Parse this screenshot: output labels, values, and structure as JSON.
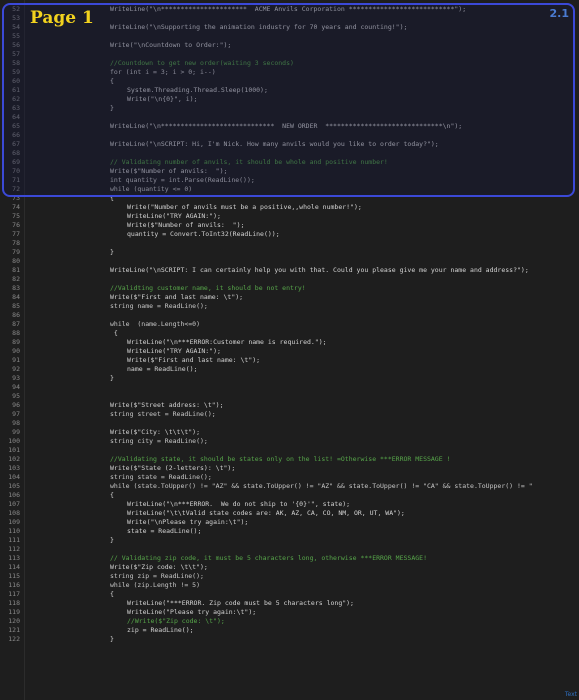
{
  "overlay": {
    "page_label": "Page 1",
    "version_label": "2.1",
    "watermark": "Text"
  },
  "lines": [
    {
      "n": "52",
      "indent": 0,
      "code": "WriteLine(\"\\n**********************  ACME Anvils Corporation ***************************\");",
      "kind": "plain"
    },
    {
      "n": "53",
      "indent": 0,
      "code": "",
      "kind": "plain"
    },
    {
      "n": "54",
      "indent": 0,
      "code": "WriteLine(\"\\nSupporting the animation industry for 70 years and counting!\");",
      "kind": "plain"
    },
    {
      "n": "55",
      "indent": 0,
      "code": "",
      "kind": "plain"
    },
    {
      "n": "56",
      "indent": 0,
      "code": "Write(\"\\nCountdown to Order:\");",
      "kind": "plain"
    },
    {
      "n": "57",
      "indent": 0,
      "code": "",
      "kind": "plain"
    },
    {
      "n": "58",
      "indent": 0,
      "code": "//Countdown to get new order(waiting 3 seconds)",
      "kind": "comment"
    },
    {
      "n": "59",
      "indent": 0,
      "code": "for (int i = 3; i > 0; i--)",
      "kind": "keyword"
    },
    {
      "n": "60",
      "indent": 0,
      "code": "{",
      "kind": "plain"
    },
    {
      "n": "61",
      "indent": 1,
      "code": "System.Threading.Thread.Sleep(1000);",
      "kind": "plain"
    },
    {
      "n": "62",
      "indent": 1,
      "code": "Write(\"\\n{0}\", i);",
      "kind": "plain"
    },
    {
      "n": "63",
      "indent": 0,
      "code": "}",
      "kind": "plain"
    },
    {
      "n": "64",
      "indent": 0,
      "code": "",
      "kind": "plain"
    },
    {
      "n": "65",
      "indent": 0,
      "code": "WriteLine(\"\\n*****************************  NEW ORDER  ******************************\\n\");",
      "kind": "plain"
    },
    {
      "n": "66",
      "indent": 0,
      "code": "",
      "kind": "plain"
    },
    {
      "n": "67",
      "indent": 0,
      "code": "WriteLine(\"\\nSCRIPT: Hi, I'm Nick. How many anvils would you like to order today?\");",
      "kind": "plain"
    },
    {
      "n": "68",
      "indent": 0,
      "code": "",
      "kind": "plain"
    },
    {
      "n": "69",
      "indent": 0,
      "code": "// Validating number of anvils, it should be whole and positive number!",
      "kind": "comment"
    },
    {
      "n": "70",
      "indent": 0,
      "code": "Write($\"Number of anvils:  \");",
      "kind": "plain"
    },
    {
      "n": "71",
      "indent": 0,
      "code": "int quantity = int.Parse(ReadLine());",
      "kind": "keyword"
    },
    {
      "n": "72",
      "indent": 0,
      "code": "while (quantity <= 0)",
      "kind": "keyword"
    },
    {
      "n": "73",
      "indent": 0,
      "code": "{",
      "kind": "plain"
    },
    {
      "n": "74",
      "indent": 1,
      "code": "Write(\"Number of anvils must be a positive,,whole number!\");",
      "kind": "plain"
    },
    {
      "n": "75",
      "indent": 1,
      "code": "WriteLine(\"TRY AGAIN:\");",
      "kind": "plain"
    },
    {
      "n": "76",
      "indent": 1,
      "code": "Write($\"Number of anvils:  \");",
      "kind": "plain"
    },
    {
      "n": "77",
      "indent": 1,
      "code": "quantity = Convert.ToInt32(ReadLine());",
      "kind": "plain"
    },
    {
      "n": "78",
      "indent": 0,
      "code": "",
      "kind": "plain"
    },
    {
      "n": "79",
      "indent": 0,
      "code": "}",
      "kind": "plain"
    },
    {
      "n": "80",
      "indent": 0,
      "code": "",
      "kind": "plain"
    },
    {
      "n": "81",
      "indent": 0,
      "code": "WriteLine(\"\\nSCRIPT: I can certainly help you with that. Could you please give me your name and address?\");",
      "kind": "plain"
    },
    {
      "n": "82",
      "indent": 0,
      "code": "",
      "kind": "plain"
    },
    {
      "n": "83",
      "indent": 0,
      "code": "//Validting customer name, it should be not entry!",
      "kind": "comment"
    },
    {
      "n": "84",
      "indent": 0,
      "code": "Write($\"First and last name: \\t\");",
      "kind": "plain"
    },
    {
      "n": "85",
      "indent": 0,
      "code": "string name = ReadLine();",
      "kind": "keyword"
    },
    {
      "n": "86",
      "indent": 0,
      "code": "",
      "kind": "plain"
    },
    {
      "n": "87",
      "indent": 0,
      "code": "while  (name.Length<=0)",
      "kind": "keyword"
    },
    {
      "n": "88",
      "indent": 0,
      "code": " {",
      "kind": "plain"
    },
    {
      "n": "89",
      "indent": 1,
      "code": "WriteLine(\"\\n***ERROR:Customer name is required.\");",
      "kind": "plain"
    },
    {
      "n": "90",
      "indent": 1,
      "code": "WriteLine(\"TRY AGAIN:\");",
      "kind": "plain"
    },
    {
      "n": "91",
      "indent": 1,
      "code": "Write($\"First and last name: \\t\");",
      "kind": "plain"
    },
    {
      "n": "92",
      "indent": 1,
      "code": "name = ReadLine();",
      "kind": "plain"
    },
    {
      "n": "93",
      "indent": 0,
      "code": "}",
      "kind": "plain"
    },
    {
      "n": "94",
      "indent": 0,
      "code": "",
      "kind": "plain"
    },
    {
      "n": "95",
      "indent": 0,
      "code": "",
      "kind": "plain"
    },
    {
      "n": "96",
      "indent": 0,
      "code": "Write($\"Street address: \\t\");",
      "kind": "plain"
    },
    {
      "n": "97",
      "indent": 0,
      "code": "string street = ReadLine();",
      "kind": "keyword"
    },
    {
      "n": "98",
      "indent": 0,
      "code": "",
      "kind": "plain"
    },
    {
      "n": "99",
      "indent": 0,
      "code": "Write($\"City: \\t\\t\\t\");",
      "kind": "plain"
    },
    {
      "n": "100",
      "indent": 0,
      "code": "string city = ReadLine();",
      "kind": "keyword"
    },
    {
      "n": "101",
      "indent": 0,
      "code": "",
      "kind": "plain"
    },
    {
      "n": "102",
      "indent": 0,
      "code": "//Validating state, it should be states only on the list! =Otherwise ***ERROR MESSAGE !",
      "kind": "comment"
    },
    {
      "n": "103",
      "indent": 0,
      "code": "Write($\"State (2-letters): \\t\");",
      "kind": "plain"
    },
    {
      "n": "104",
      "indent": 0,
      "code": "string state = ReadLine();",
      "kind": "keyword"
    },
    {
      "n": "105",
      "indent": 0,
      "code": "while (state.ToUpper() != \"AZ\" && state.ToUpper() != \"AZ\" && state.ToUpper() != \"CA\" && state.ToUpper() != \"",
      "kind": "keyword"
    },
    {
      "n": "106",
      "indent": 0,
      "code": "{",
      "kind": "plain"
    },
    {
      "n": "107",
      "indent": 1,
      "code": "WriteLine(\"\\n***ERROR.  We do not ship to '{0}'\", state);",
      "kind": "plain"
    },
    {
      "n": "108",
      "indent": 1,
      "code": "WriteLine(\"\\t\\tValid state codes are: AK, AZ, CA, CO, NM, OR, UT, WA\");",
      "kind": "plain"
    },
    {
      "n": "109",
      "indent": 1,
      "code": "Write(\"\\nPlease try again:\\t\");",
      "kind": "plain"
    },
    {
      "n": "110",
      "indent": 1,
      "code": "state = ReadLine();",
      "kind": "plain"
    },
    {
      "n": "111",
      "indent": 0,
      "code": "}",
      "kind": "plain"
    },
    {
      "n": "112",
      "indent": 0,
      "code": "",
      "kind": "plain"
    },
    {
      "n": "113",
      "indent": 0,
      "code": "// Validating zip code, it must be 5 characters long, otherwise ***ERROR MESSAGE!",
      "kind": "comment"
    },
    {
      "n": "114",
      "indent": 0,
      "code": "Write($\"Zip code: \\t\\t\");",
      "kind": "plain"
    },
    {
      "n": "115",
      "indent": 0,
      "code": "string zip = ReadLine();",
      "kind": "keyword"
    },
    {
      "n": "116",
      "indent": 0,
      "code": "while (zip.Length != 5)",
      "kind": "keyword"
    },
    {
      "n": "117",
      "indent": 0,
      "code": "{",
      "kind": "plain"
    },
    {
      "n": "118",
      "indent": 1,
      "code": "WriteLine(\"***ERROR. Zip code must be 5 characters long\");",
      "kind": "plain"
    },
    {
      "n": "119",
      "indent": 1,
      "code": "WriteLine(\"Please try again:\\t\");",
      "kind": "plain"
    },
    {
      "n": "120",
      "indent": 1,
      "code": "//Write($\"Zip code: \\t\");",
      "kind": "comment"
    },
    {
      "n": "121",
      "indent": 1,
      "code": "zip = ReadLine();",
      "kind": "plain"
    },
    {
      "n": "122",
      "indent": 0,
      "code": "}",
      "kind": "plain"
    }
  ]
}
